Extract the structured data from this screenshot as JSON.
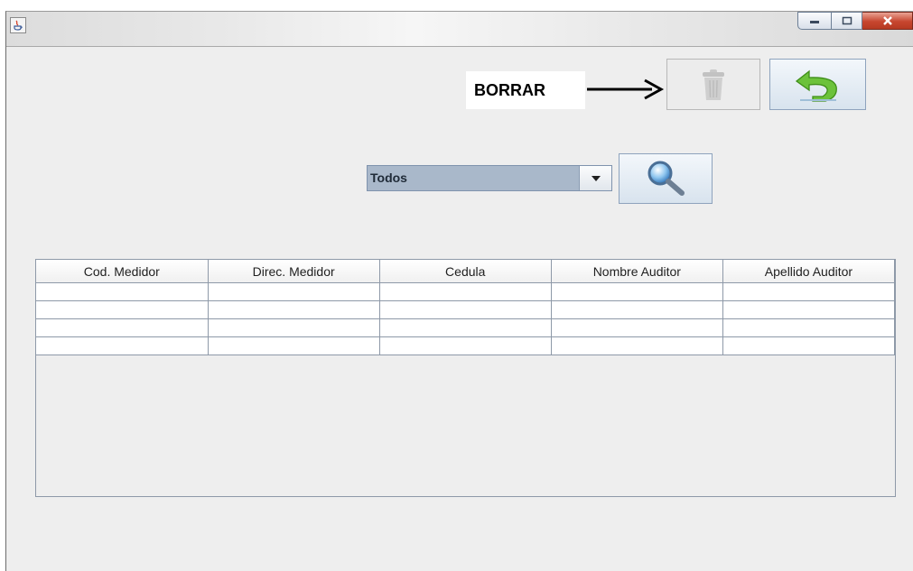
{
  "window": {
    "title": "",
    "controls": {
      "minimize_icon": "minimize-icon",
      "maximize_icon": "maximize-icon",
      "close_icon": "close-icon"
    }
  },
  "annotation": {
    "label": "BORRAR"
  },
  "toolbar": {
    "delete_icon": "trash-icon",
    "back_icon": "undo-arrow-icon"
  },
  "filter": {
    "selected": "Todos",
    "search_icon": "magnifier-icon"
  },
  "table": {
    "columns": [
      "Cod. Medidor",
      "Direc. Medidor",
      "Cedula",
      "Nombre Auditor",
      "Apellido Auditor"
    ],
    "rows": [
      [
        "",
        "",
        "",
        "",
        ""
      ],
      [
        "",
        "",
        "",
        "",
        ""
      ],
      [
        "",
        "",
        "",
        "",
        ""
      ],
      [
        "",
        "",
        "",
        "",
        ""
      ]
    ]
  },
  "colors": {
    "accent": "#a9b8ca",
    "close": "#c7462f",
    "back_arrow": "#5cb82a"
  }
}
